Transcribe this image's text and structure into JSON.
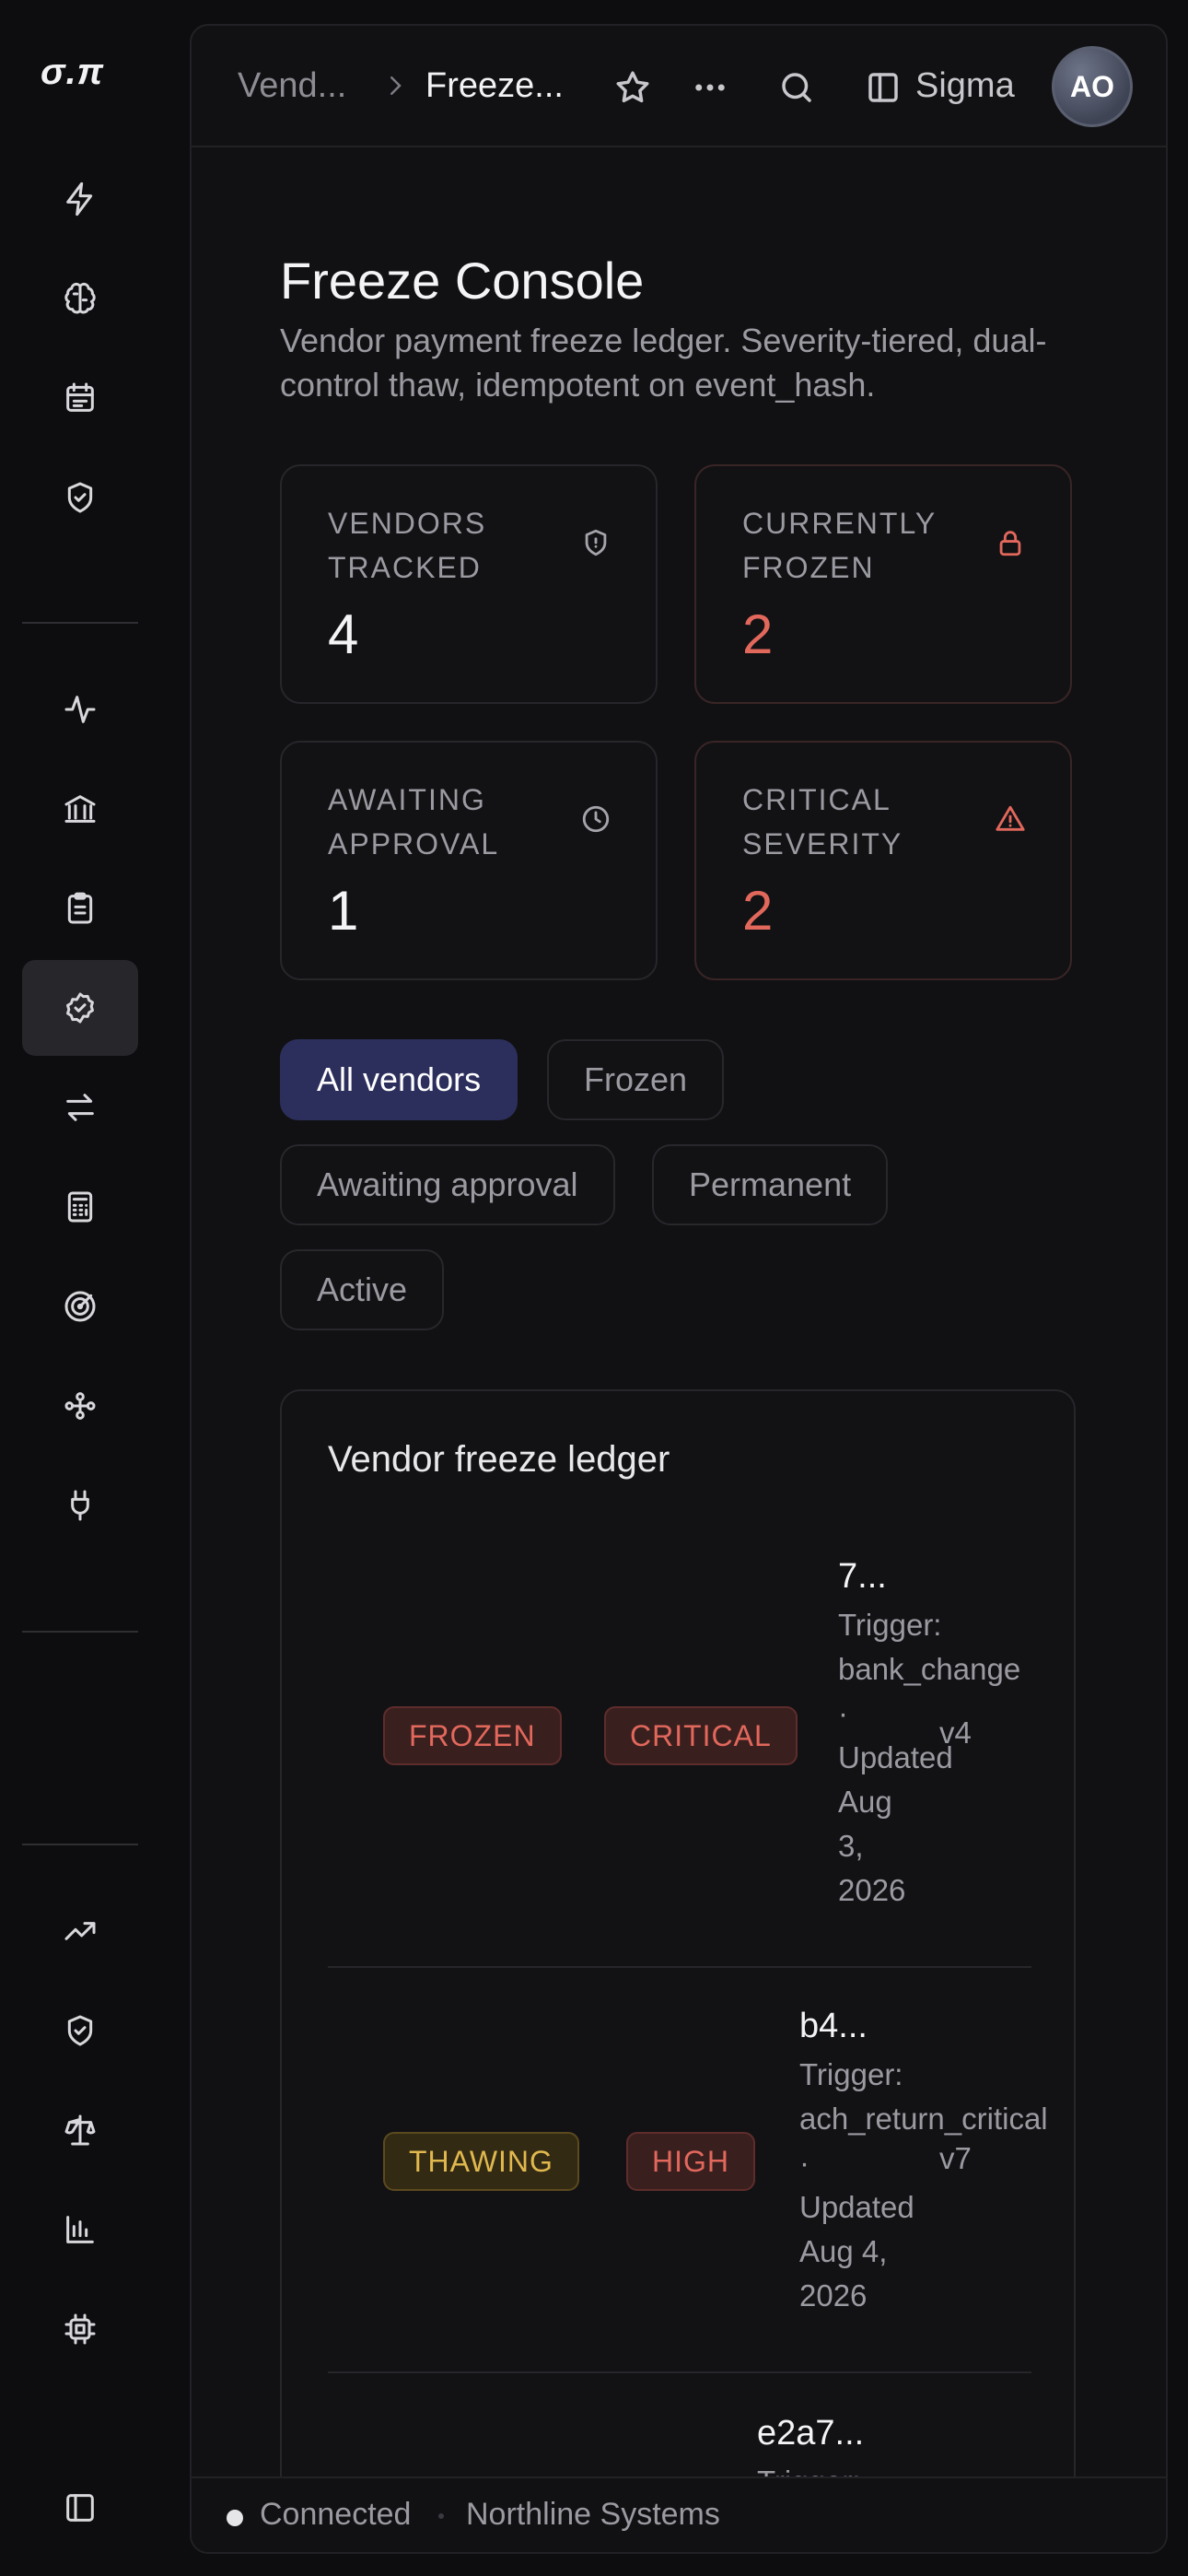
{
  "brand": {
    "logo": "σ.π"
  },
  "rail": {
    "top_icons": [
      "bolt-icon",
      "brain-icon",
      "calendar-icon",
      "shield-check-icon"
    ],
    "mid_icons": [
      "activity-icon",
      "bank-icon",
      "clipboard-icon",
      "badge-check-icon",
      "transfer-icon",
      "calculator-icon",
      "target-icon",
      "workflow-icon",
      "plug-icon"
    ],
    "bottom_icons": [
      "trending-up-icon",
      "shield-check-icon",
      "scale-icon",
      "bar-chart-icon",
      "cpu-icon"
    ],
    "footer_icon": "sidebar-toggle-icon",
    "active_item": "badge-check-icon"
  },
  "header": {
    "breadcrumb_parent": "Vend...",
    "breadcrumb_current": "Freeze...",
    "workspace_label": "Sigma",
    "avatar_initials": "AO"
  },
  "page": {
    "title": "Freeze Console",
    "description": "Vendor payment freeze ledger. Severity-tiered, dual-control thaw, idempotent on event_hash."
  },
  "stats": [
    {
      "label": "Vendors tracked",
      "value": "4",
      "icon": "shield-icon"
    },
    {
      "label": "Currently frozen",
      "value": "2",
      "icon": "lock-icon"
    },
    {
      "label": "Awaiting approval",
      "value": "1",
      "icon": "clock-icon"
    },
    {
      "label": "Critical severity",
      "value": "2",
      "icon": "alert-triangle-icon"
    }
  ],
  "filters": {
    "options": [
      "All vendors",
      "Frozen",
      "Awaiting approval",
      "Permanent",
      "Active"
    ],
    "selected": "All vendors"
  },
  "ledger": {
    "title": "Vendor freeze ledger",
    "rows": [
      {
        "status": "FROZEN",
        "severity": "CRITICAL",
        "id": "7...",
        "meta_lines": [
          "Trigger:",
          "bank_change",
          "·",
          "Updated",
          "Aug",
          "3,",
          "2026"
        ],
        "version": "v4"
      },
      {
        "status": "THAWING",
        "severity": "HIGH",
        "id": "b4...",
        "meta_lines": [
          "Trigger:",
          "ach_return_critical",
          "·",
          "Updated",
          "Aug 4,",
          "2026"
        ],
        "version": "v7"
      },
      {
        "id": "e2a7...",
        "meta_lines": [
          "Trigger:"
        ]
      }
    ]
  },
  "status_bar": {
    "connection": "Connected",
    "organization": "Northline Systems"
  },
  "colors": {
    "background": "#0d0d0f",
    "panel": "#111113",
    "accent_chip": "#2c2f5c",
    "danger": "#e2685c",
    "warning": "#e0b84e"
  }
}
